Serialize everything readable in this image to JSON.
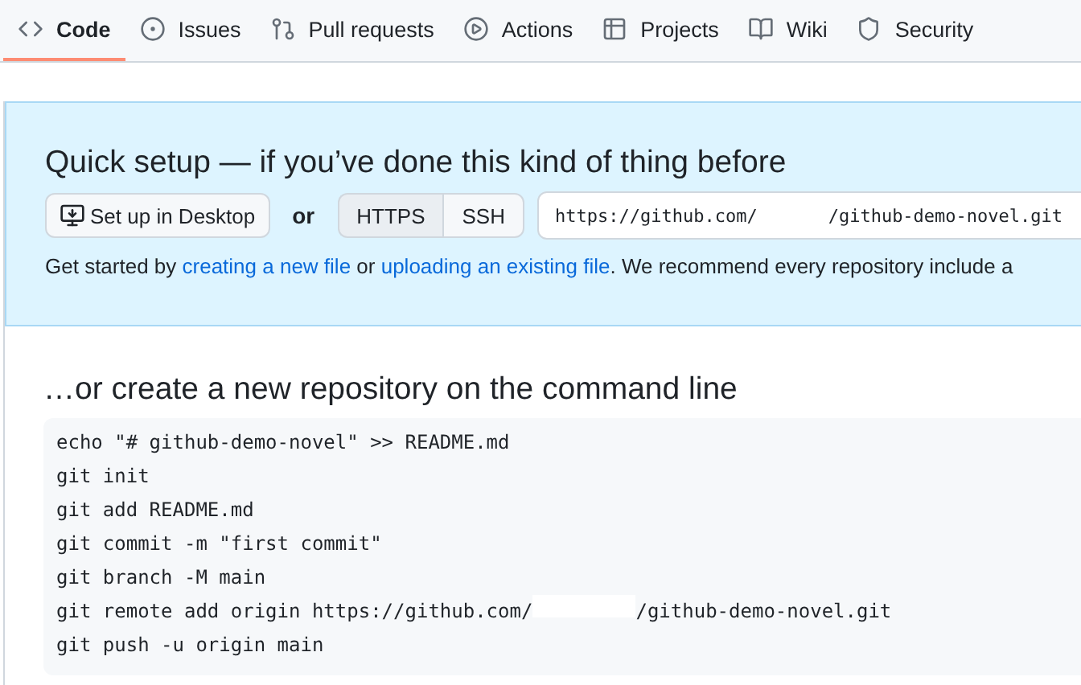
{
  "tabs": [
    {
      "label": "Code",
      "selected": true
    },
    {
      "label": "Issues",
      "selected": false
    },
    {
      "label": "Pull requests",
      "selected": false
    },
    {
      "label": "Actions",
      "selected": false
    },
    {
      "label": "Projects",
      "selected": false
    },
    {
      "label": "Wiki",
      "selected": false
    },
    {
      "label": "Security",
      "selected": false
    }
  ],
  "quick_setup": {
    "title": "Quick setup — if you’ve done this kind of thing before",
    "desktop_button": "Set up in Desktop",
    "or": "or",
    "protocols": [
      {
        "label": "HTTPS",
        "selected": true
      },
      {
        "label": "SSH",
        "selected": false
      }
    ],
    "url_start": "https://github.com/",
    "url_end": "/github-demo-novel.git",
    "help": [
      {
        "kind": "text",
        "text": "Get started by "
      },
      {
        "kind": "link",
        "text": "creating a new file"
      },
      {
        "kind": "text",
        "text": " or "
      },
      {
        "kind": "link",
        "text": "uploading an existing file"
      },
      {
        "kind": "text",
        "text": ". We recommend every repository include a"
      }
    ]
  },
  "command_line": {
    "title": "…or create a new repository on the command line",
    "lines": [
      {
        "text": "echo \"# github-demo-novel\" >> README.md"
      },
      {
        "text": "git init"
      },
      {
        "text": "git add README.md"
      },
      {
        "text": "git commit -m \"first commit\""
      },
      {
        "text": "git branch -M main"
      },
      {
        "text": "git remote add origin https://github.com/",
        "after_redaction": "/github-demo-novel.git"
      },
      {
        "text": "git push -u origin main"
      }
    ]
  }
}
